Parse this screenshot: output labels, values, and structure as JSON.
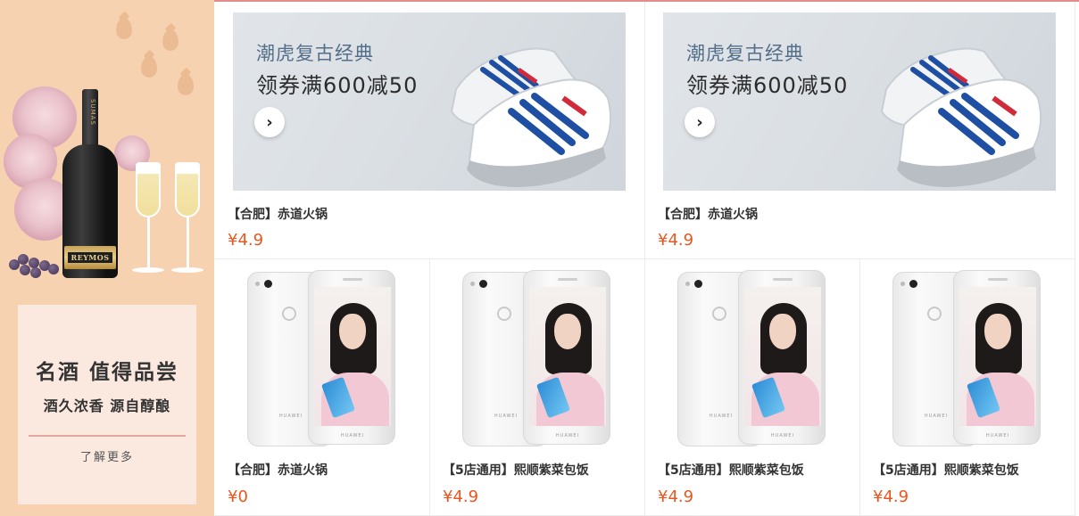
{
  "left_banner": {
    "bottle_brand": "REYMOS",
    "bottle_neck_text": "SUMAS",
    "title": "名酒 值得品尝",
    "subtitle": "酒久浓香 源自醇酿",
    "more_label": "了解更多",
    "background_color": "#f7d2b1"
  },
  "top_row": [
    {
      "banner_line1": "潮虎复古经典",
      "banner_line2": "领券满600减50",
      "name": "【合肥】赤道火锅",
      "price": "¥4.9"
    },
    {
      "banner_line1": "潮虎复古经典",
      "banner_line2": "领券满600减50",
      "name": "【合肥】赤道火锅",
      "price": "¥4.9"
    }
  ],
  "bottom_row": [
    {
      "name": "【合肥】赤道火锅",
      "price": "¥0",
      "brand": "HUAWEI"
    },
    {
      "name": "【5店通用】熙顺紫菜包饭",
      "price": "¥4.9",
      "brand": "HUAWEI"
    },
    {
      "name": "【5店通用】熙顺紫菜包饭",
      "price": "¥4.9",
      "brand": "HUAWEI"
    },
    {
      "name": "【5店通用】熙顺紫菜包饭",
      "price": "¥4.9",
      "brand": "HUAWEI"
    }
  ],
  "icons": {
    "banner_arrow": "chevron-right-icon"
  },
  "colors": {
    "price": "#e8561e",
    "accent_line": "#e38c8c"
  }
}
